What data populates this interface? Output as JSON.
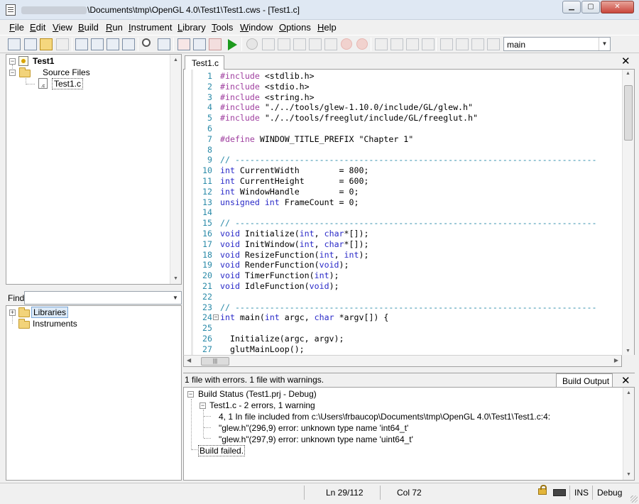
{
  "window": {
    "title_path": "\\Documents\\tmp\\OpenGL 4.0\\Test1\\Test1.cws - [Test1.c]",
    "minimize": "▁",
    "maximize": "▢",
    "close": "✕"
  },
  "menu": [
    {
      "label": "File",
      "u": "F",
      "rest": "ile"
    },
    {
      "label": "Edit",
      "u": "E",
      "rest": "dit"
    },
    {
      "label": "View",
      "u": "V",
      "rest": "iew"
    },
    {
      "label": "Build",
      "u": "B",
      "rest": "uild"
    },
    {
      "label": "Run",
      "u": "R",
      "rest": "un"
    },
    {
      "label": "Instrument",
      "u": "I",
      "rest": "nstrument"
    },
    {
      "label": "Library",
      "u": "L",
      "rest": "ibrary"
    },
    {
      "label": "Tools",
      "u": "T",
      "rest": "ools"
    },
    {
      "label": "Window",
      "u": "W",
      "rest": "indow"
    },
    {
      "label": "Options",
      "u": "O",
      "rest": "ptions"
    },
    {
      "label": "Help",
      "u": "H",
      "rest": "elp"
    }
  ],
  "toolbar": {
    "function_combo": "main",
    "combo_arrow": "▼"
  },
  "project_tree": {
    "project": "Test1",
    "folder": "Source Files",
    "file": "Test1.c",
    "file_icon_text": ".c"
  },
  "find": {
    "label": "Find",
    "value": "",
    "arrow": "▼"
  },
  "library_tree": {
    "items": [
      "Libraries",
      "Instruments"
    ]
  },
  "editor": {
    "tab": "Test1.c",
    "close": "✕",
    "lines": [
      {
        "n": "1",
        "t": "#include <stdlib.h>"
      },
      {
        "n": "2",
        "t": "#include <stdio.h>"
      },
      {
        "n": "3",
        "t": "#include <string.h>"
      },
      {
        "n": "4",
        "t": "#include \"./../tools/glew-1.10.0/include/GL/glew.h\""
      },
      {
        "n": "5",
        "t": "#include \"./../tools/freeglut/include/GL/freeglut.h\""
      },
      {
        "n": "6",
        "t": ""
      },
      {
        "n": "7",
        "t": "#define WINDOW_TITLE_PREFIX \"Chapter 1\""
      },
      {
        "n": "8",
        "t": ""
      },
      {
        "n": "9",
        "t": "// -------------------------------------------------------------------------"
      },
      {
        "n": "10",
        "t": "int CurrentWidth        = 800;"
      },
      {
        "n": "11",
        "t": "int CurrentHeight       = 600;"
      },
      {
        "n": "12",
        "t": "int WindowHandle        = 0;"
      },
      {
        "n": "13",
        "t": "unsigned int FrameCount = 0;"
      },
      {
        "n": "14",
        "t": ""
      },
      {
        "n": "15",
        "t": "// -------------------------------------------------------------------------"
      },
      {
        "n": "16",
        "t": "void Initialize(int, char*[]);"
      },
      {
        "n": "17",
        "t": "void InitWindow(int, char*[]);"
      },
      {
        "n": "18",
        "t": "void ResizeFunction(int, int);"
      },
      {
        "n": "19",
        "t": "void RenderFunction(void);"
      },
      {
        "n": "20",
        "t": "void TimerFunction(int);"
      },
      {
        "n": "21",
        "t": "void IdleFunction(void);"
      },
      {
        "n": "22",
        "t": ""
      },
      {
        "n": "23",
        "t": "// -------------------------------------------------------------------------"
      },
      {
        "n": "24",
        "t": "int main(int argc, char *argv[]) {",
        "fold": true
      },
      {
        "n": "25",
        "t": ""
      },
      {
        "n": "26",
        "t": "  Initialize(argc, argv);"
      },
      {
        "n": "27",
        "t": "  glutMainLoop();"
      }
    ]
  },
  "output": {
    "summary": "1 file with errors.  1 file with warnings.",
    "tab": "Build Output",
    "close": "✕",
    "rows": [
      "Build Status (Test1.prj - Debug)",
      "Test1.c - 2 errors, 1 warning",
      "4, 1    In file included from c:\\Users\\frbaucop\\Documents\\tmp\\OpenGL 4.0\\Test1\\Test1.c:4:",
      "\"glew.h\"(296,9)    error: unknown type name 'int64_t'",
      "\"glew.h\"(297,9)    error: unknown type name 'uint64_t'",
      "Build failed."
    ]
  },
  "status": {
    "line": "Ln 29/112",
    "col": "Col 72",
    "ins": "INS",
    "config": "Debug"
  }
}
